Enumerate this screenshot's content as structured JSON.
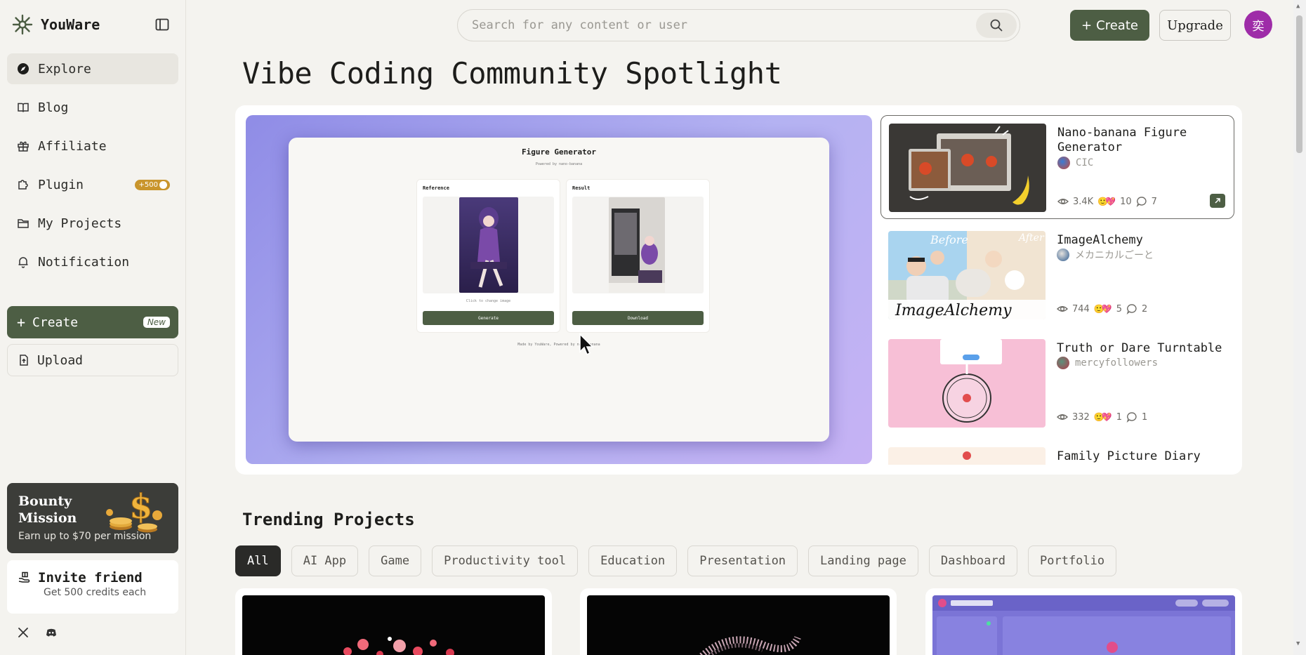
{
  "brand": {
    "name": "YouWare"
  },
  "nav": {
    "items": [
      {
        "label": "Explore",
        "icon": "compass-icon",
        "active": true
      },
      {
        "label": "Blog",
        "icon": "book-icon"
      },
      {
        "label": "Affiliate",
        "icon": "gift-icon"
      },
      {
        "label": "Plugin",
        "icon": "puzzle-icon",
        "badge": "+500"
      },
      {
        "label": "My Projects",
        "icon": "folder-icon"
      },
      {
        "label": "Notification",
        "icon": "bell-icon"
      }
    ],
    "create_label": "Create",
    "create_badge": "New",
    "upload_label": "Upload"
  },
  "bounty": {
    "title": "Bounty Mission",
    "subtitle": "Earn up to $70 per mission"
  },
  "invite": {
    "title": "Invite friend",
    "subtitle": "Get 500 credits each"
  },
  "header": {
    "search_placeholder": "Search for any content or user",
    "create_label": "Create",
    "upgrade_label": "Upgrade",
    "avatar_initial": "奕"
  },
  "page_title": "Vibe Coding Community Spotlight",
  "hero": {
    "app_title": "Figure Generator",
    "app_subtitle": "Powered by nano-banana",
    "reference_label": "Reference",
    "result_label": "Result",
    "change_hint": "Click to change image",
    "generate_label": "Generate",
    "download_label": "Download",
    "footer": "Made by YouWare, Powered by nano-banana"
  },
  "spotlight": [
    {
      "title": "Nano-banana Figure Generator",
      "author": "CIC",
      "views": "3.4K",
      "reactions": "10",
      "comments": "7",
      "active": true
    },
    {
      "title": "ImageAlchemy",
      "author": "メカニカルごーと",
      "views": "744",
      "reactions": "5",
      "comments": "2"
    },
    {
      "title": "Truth or Dare Turntable",
      "author": "mercyfollowers",
      "views": "332",
      "reactions": "1",
      "comments": "1"
    },
    {
      "title": "Family Picture Diary"
    }
  ],
  "thumb_text": {
    "before": "Before",
    "after": "After",
    "brand": "ImageAlchemy"
  },
  "trending": {
    "title": "Trending Projects",
    "filters": [
      "All",
      "AI App",
      "Game",
      "Productivity tool",
      "Education",
      "Presentation",
      "Landing page",
      "Dashboard",
      "Portfolio"
    ]
  },
  "colors": {
    "accent": "#4d5e44",
    "avatar": "#9e2ca8",
    "badge": "#c9952c"
  }
}
